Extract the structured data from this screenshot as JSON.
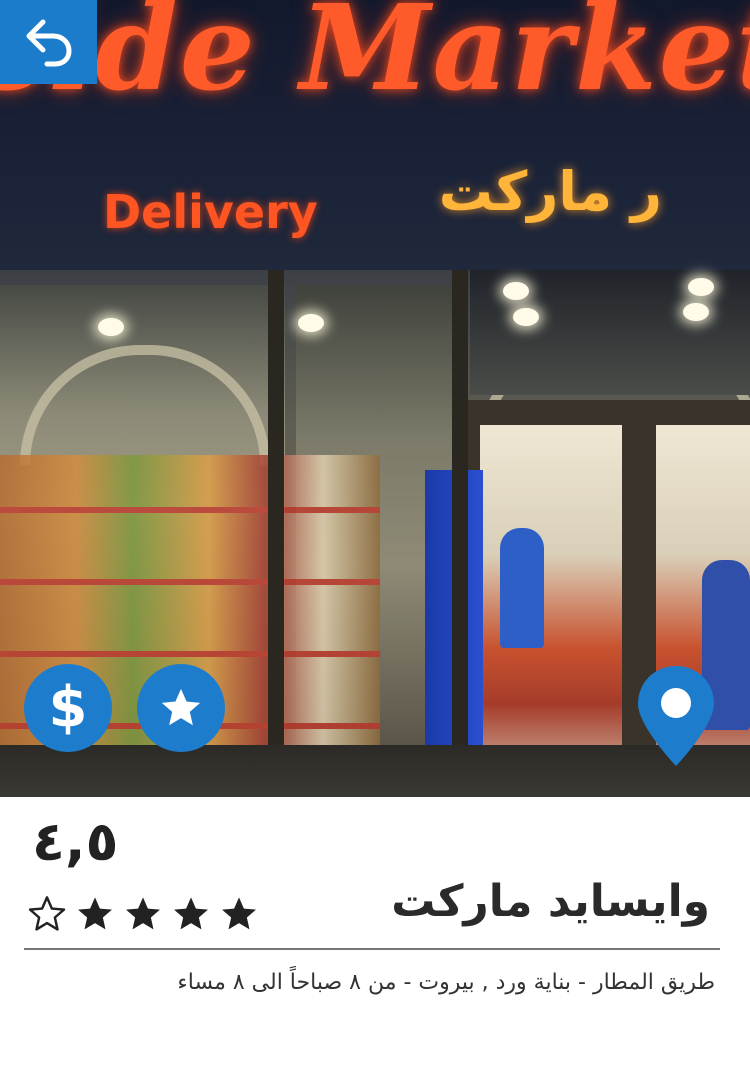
{
  "header": {
    "back_icon": "back-arrow-icon"
  },
  "photo": {
    "sign_text": "side Market",
    "sign_delivery": "Delivery",
    "sign_arabic": "ر ماركت"
  },
  "actions": {
    "price_icon": "dollar-icon",
    "favorite_icon": "star-icon",
    "location_icon": "location-pin-icon"
  },
  "store": {
    "rating": "٤,٥",
    "rating_value": 4.5,
    "rating_max": 5,
    "name": "وايسايد ماركت",
    "address": "طريق المطار - بناية ورد , بيروت - من ٨ صباحاً الى ٨ مساء"
  },
  "colors": {
    "accent": "#1d7ccc",
    "text": "#2a2a2a"
  }
}
